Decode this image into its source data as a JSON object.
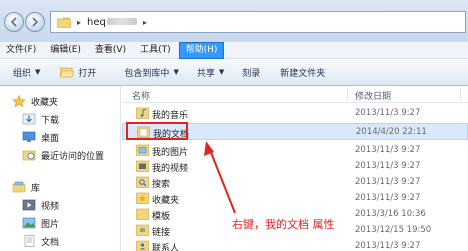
{
  "address": {
    "crumb_prefix": "heq",
    "crumb_sep_1": "▸",
    "crumb_sep_2": "▸"
  },
  "menu": [
    {
      "label": "文件(F)"
    },
    {
      "label": "编辑(E)"
    },
    {
      "label": "查看(V)"
    },
    {
      "label": "工具(T)"
    },
    {
      "label": "帮助(H)",
      "active": true
    }
  ],
  "toolbar": {
    "organize": "组织",
    "open": "打开",
    "include_in_library": "包含到库中",
    "share": "共享",
    "burn": "刻录",
    "new_folder": "新建文件夹"
  },
  "sidebar": {
    "favorites": "收藏夹",
    "downloads": "下载",
    "desktop": "桌面",
    "recent_places": "最近访问的位置",
    "libraries": "库",
    "videos": "视频",
    "pictures": "图片",
    "documents": "文档"
  },
  "columns": {
    "name": "名称",
    "date_modified": "修改日期"
  },
  "files": [
    {
      "name": "我的音乐",
      "date": "2013/11/3 9:27",
      "icon": "music-folder-icon"
    },
    {
      "name": "我的文档",
      "date": "2014/4/20 22:11",
      "icon": "documents-folder-icon",
      "selected": true
    },
    {
      "name": "我的图片",
      "date": "2013/11/3 9:27",
      "icon": "pictures-folder-icon"
    },
    {
      "name": "我的视频",
      "date": "2013/11/3 9:27",
      "icon": "videos-folder-icon"
    },
    {
      "name": "搜索",
      "date": "2013/11/3 9:27",
      "icon": "searches-folder-icon"
    },
    {
      "name": "收藏夹",
      "date": "2013/11/3 9:27",
      "icon": "favorites-folder-icon"
    },
    {
      "name": "模板",
      "date": "2013/3/16 10:36",
      "icon": "templates-folder-icon"
    },
    {
      "name": "链接",
      "date": "2013/12/15 19:50",
      "icon": "links-folder-icon"
    },
    {
      "name": "联系人",
      "date": "2013/11/3 9:27",
      "icon": "contacts-folder-icon"
    }
  ],
  "annotation": {
    "text": "右键，我的文档 属性",
    "color": "#e0231e"
  },
  "colors": {
    "menu_active": "#3399ff",
    "selection": "#d9e8fb",
    "accent_red": "#e0231e"
  }
}
